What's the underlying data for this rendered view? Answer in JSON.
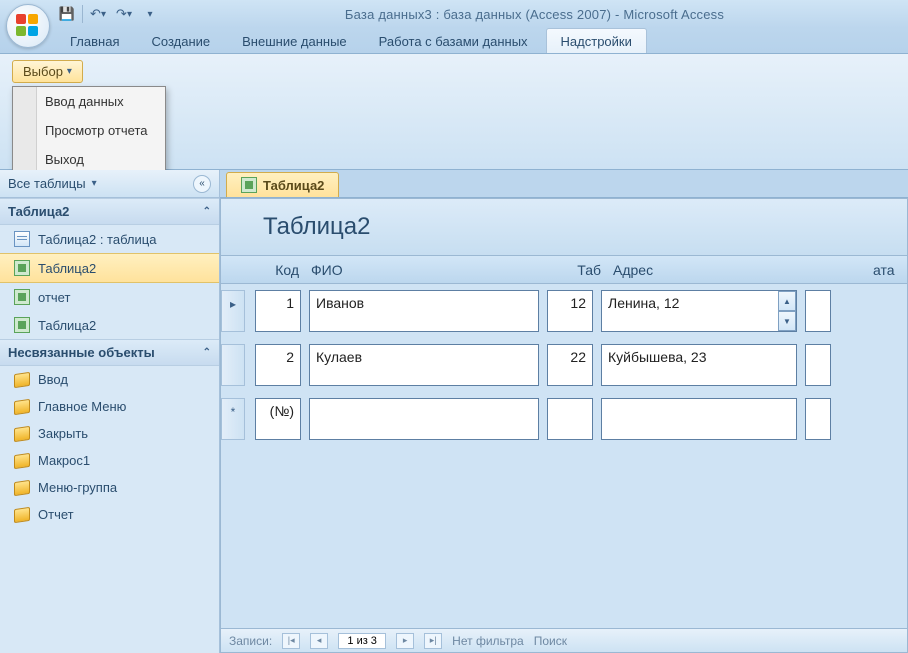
{
  "titlebar": {
    "app_title": "База данных3 : база данных (Access 2007) - Microsoft Access"
  },
  "qat": {
    "save": "💾",
    "undo": "↶",
    "redo": "↷"
  },
  "ribbon": {
    "tabs": [
      "Главная",
      "Создание",
      "Внешние данные",
      "Работа с базами данных",
      "Надстройки"
    ],
    "active_index": 4,
    "choice_button": "Выбор",
    "menu": [
      "Ввод данных",
      "Просмотр отчета",
      "Выход"
    ]
  },
  "nav": {
    "header": "Все таблицы",
    "groups": [
      {
        "title": "Таблица2",
        "items": [
          {
            "icon": "table",
            "label": "Таблица2 : таблица"
          },
          {
            "icon": "form",
            "label": "Таблица2",
            "selected": true
          },
          {
            "icon": "form",
            "label": "отчет"
          },
          {
            "icon": "form",
            "label": "Таблица2"
          }
        ]
      },
      {
        "title": "Несвязанные объекты",
        "items": [
          {
            "icon": "macro",
            "label": "Ввод"
          },
          {
            "icon": "macro",
            "label": "Главное Меню"
          },
          {
            "icon": "macro",
            "label": "Закрыть"
          },
          {
            "icon": "macro",
            "label": "Макрос1"
          },
          {
            "icon": "macro",
            "label": "Меню-группа"
          },
          {
            "icon": "macro",
            "label": "Отчет"
          }
        ]
      }
    ]
  },
  "doc": {
    "tab_label": "Таблица2",
    "form_title": "Таблица2",
    "columns": {
      "id": "Код",
      "fio": "ФИО",
      "tab": "Таб",
      "addr": "Адрес",
      "ata": "ата"
    },
    "rows": [
      {
        "selector": "▸",
        "id": "1",
        "fio": "Иванов",
        "tab": "12",
        "addr": "Ленина, 12",
        "spin": true
      },
      {
        "selector": "",
        "id": "2",
        "fio": "Кулаев",
        "tab": "22",
        "addr": "Куйбышева, 23"
      },
      {
        "selector": "*",
        "id": "(№)",
        "fio": "",
        "tab": "",
        "addr": ""
      }
    ]
  },
  "status": {
    "records_label": "Записи:",
    "position": "1 из 3",
    "no_filter": "Нет фильтра",
    "search": "Поиск"
  }
}
